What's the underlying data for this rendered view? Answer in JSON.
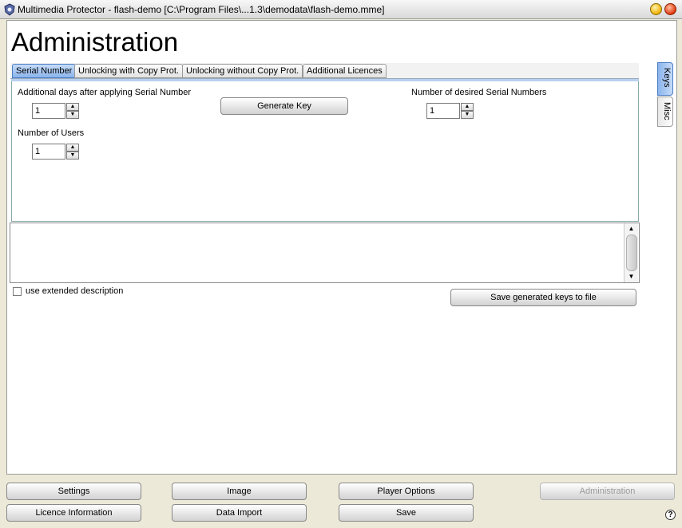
{
  "window": {
    "title": "Multimedia Protector - flash-demo [C:\\Program Files\\...1.3\\demodata\\flash-demo.mme]"
  },
  "page": {
    "title": "Administration"
  },
  "tabs": [
    {
      "label": "Serial Number",
      "active": true
    },
    {
      "label": "Unlocking with Copy Prot.",
      "active": false
    },
    {
      "label": "Unlocking without Copy Prot.",
      "active": false
    },
    {
      "label": "Additional Licences",
      "active": false
    }
  ],
  "side_tabs": [
    {
      "label": "Keys",
      "active": true
    },
    {
      "label": "Misc",
      "active": false
    }
  ],
  "serial": {
    "days_label": "Additional days after applying Serial Number",
    "days_value": "1",
    "users_label": "Number of Users",
    "users_value": "1",
    "desired_label": "Number of desired Serial Numbers",
    "desired_value": "1",
    "generate_label": "Generate Key"
  },
  "output": {
    "text": ""
  },
  "options": {
    "extended_label": "use extended description",
    "save_keys_label": "Save generated keys to file"
  },
  "nav": {
    "settings": "Settings",
    "image": "Image",
    "player_options": "Player Options",
    "administration": "Administration",
    "licence_information": "Licence Information",
    "data_import": "Data Import",
    "save": "Save"
  },
  "help": "?"
}
